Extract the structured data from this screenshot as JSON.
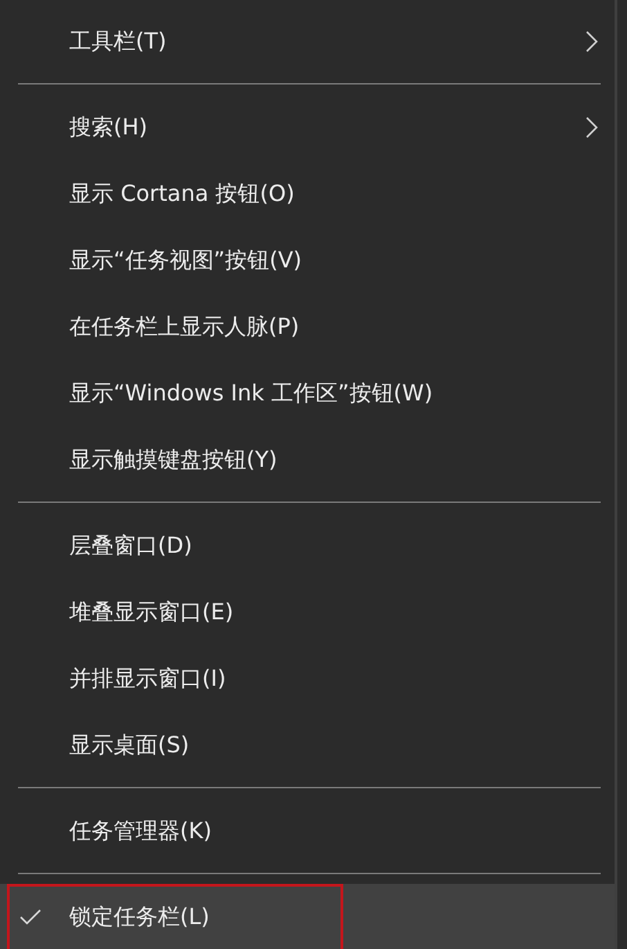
{
  "menu": {
    "groups": [
      {
        "items": [
          {
            "label": "工具栏(T)",
            "submenu": true,
            "checked": false,
            "hovered": false,
            "annotated": false
          }
        ]
      },
      {
        "items": [
          {
            "label": "搜索(H)",
            "submenu": true,
            "checked": false,
            "hovered": false,
            "annotated": false
          },
          {
            "label": "显示 Cortana 按钮(O)",
            "submenu": false,
            "checked": false,
            "hovered": false,
            "annotated": false
          },
          {
            "label": "显示“任务视图”按钮(V)",
            "submenu": false,
            "checked": false,
            "hovered": false,
            "annotated": false
          },
          {
            "label": "在任务栏上显示人脉(P)",
            "submenu": false,
            "checked": false,
            "hovered": false,
            "annotated": false
          },
          {
            "label": "显示“Windows Ink 工作区”按钮(W)",
            "submenu": false,
            "checked": false,
            "hovered": false,
            "annotated": false
          },
          {
            "label": "显示触摸键盘按钮(Y)",
            "submenu": false,
            "checked": false,
            "hovered": false,
            "annotated": false
          }
        ]
      },
      {
        "items": [
          {
            "label": "层叠窗口(D)",
            "submenu": false,
            "checked": false,
            "hovered": false,
            "annotated": false
          },
          {
            "label": "堆叠显示窗口(E)",
            "submenu": false,
            "checked": false,
            "hovered": false,
            "annotated": false
          },
          {
            "label": "并排显示窗口(I)",
            "submenu": false,
            "checked": false,
            "hovered": false,
            "annotated": false
          },
          {
            "label": "显示桌面(S)",
            "submenu": false,
            "checked": false,
            "hovered": false,
            "annotated": false
          }
        ]
      },
      {
        "items": [
          {
            "label": "任务管理器(K)",
            "submenu": false,
            "checked": false,
            "hovered": false,
            "annotated": false
          }
        ]
      },
      {
        "items": [
          {
            "label": "锁定任务栏(L)",
            "submenu": false,
            "checked": true,
            "hovered": true,
            "annotated": true
          }
        ]
      }
    ]
  }
}
